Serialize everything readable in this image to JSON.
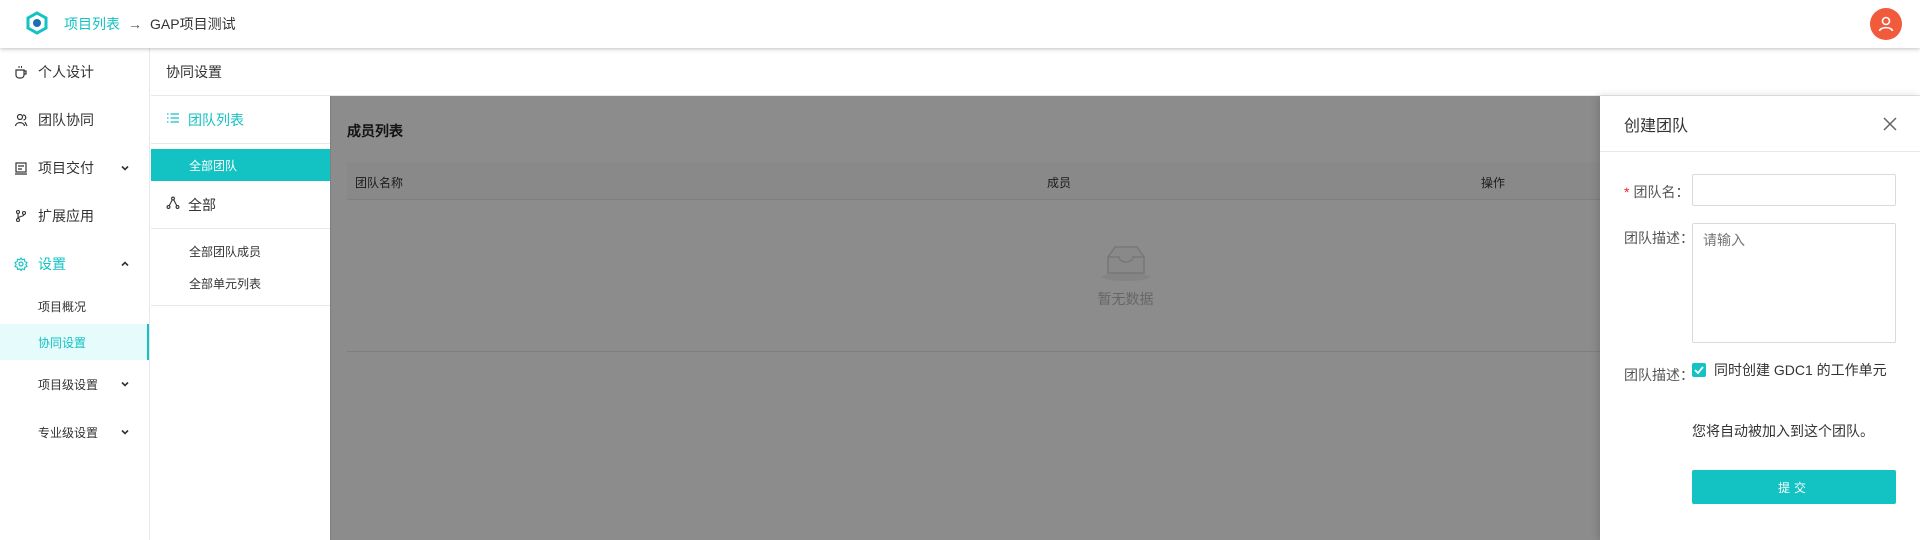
{
  "header": {
    "breadcrumb": [
      "项目列表",
      "GAP项目测试"
    ],
    "separator": "→"
  },
  "sidebar": {
    "items": [
      {
        "label": "个人设计",
        "icon": "cup-icon"
      },
      {
        "label": "团队协同",
        "icon": "users-icon"
      },
      {
        "label": "项目交付",
        "icon": "delivery-icon"
      },
      {
        "label": "扩展应用",
        "icon": "branch-icon"
      },
      {
        "label": "设置",
        "icon": "gear-icon"
      }
    ],
    "settings_sub": [
      "项目概况",
      "协同设置",
      "项目级设置",
      "专业级设置"
    ]
  },
  "content": {
    "title": "协同设置",
    "team_panel": {
      "title": "团队列表",
      "all_teams": "全部团队",
      "group": "全部",
      "sub_items": [
        "全部团队成员",
        "全部单元列表"
      ]
    },
    "members": {
      "title": "成员列表",
      "columns": [
        "团队名称",
        "成员",
        "操作"
      ],
      "empty_text": "暂无数据"
    }
  },
  "drawer": {
    "title": "创建团队",
    "team_name_label": "团队名：",
    "team_desc_label": "团队描述：",
    "desc_placeholder": "请输入",
    "checkbox_label": "团队描述：",
    "checkbox_text": "同时创建 GDC1 的工作单元",
    "note": "您将自动被加入到这个团队。",
    "submit": "提交"
  },
  "colors": {
    "accent": "#13c2c2",
    "avatar": "#f25a3c",
    "required": "#f5222d"
  }
}
